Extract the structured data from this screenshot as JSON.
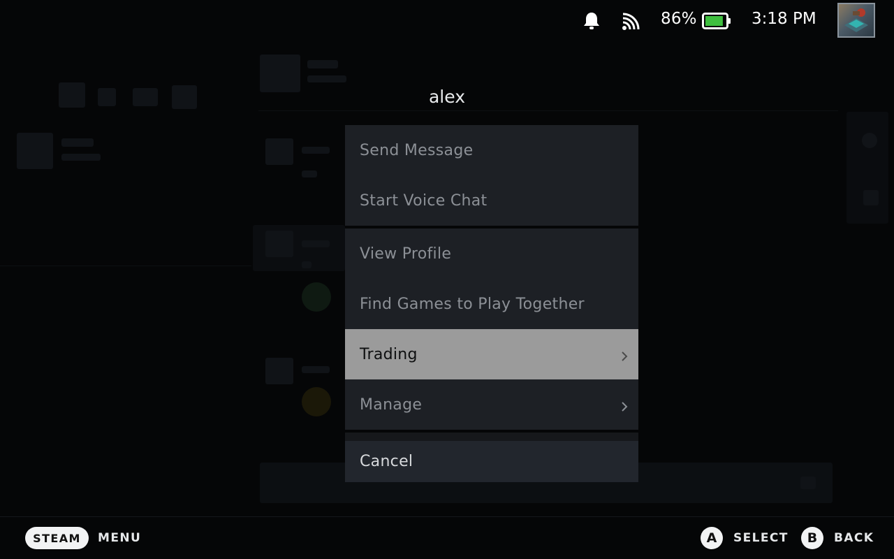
{
  "status_bar": {
    "notification_icon": "bell-icon",
    "network_icon": "wifi-icon",
    "battery_percent": "86%",
    "battery_level": 0.86,
    "battery_color": "#3fbf3f",
    "time": "3:18 PM",
    "avatar_icon": "user-avatar"
  },
  "context_menu": {
    "title": "alex",
    "groups": [
      [
        {
          "label": "Send Message"
        },
        {
          "label": "Start Voice Chat"
        }
      ],
      [
        {
          "label": "View Profile"
        },
        {
          "label": "Find Games to Play Together"
        },
        {
          "label": "Trading",
          "submenu": true,
          "selected": true
        },
        {
          "label": "Manage",
          "submenu": true
        }
      ]
    ],
    "cancel_label": "Cancel"
  },
  "bottom_bar": {
    "steam_label": "STEAM",
    "menu_label": "MENU",
    "a_button": "A",
    "select_label": "SELECT",
    "b_button": "B",
    "back_label": "BACK"
  }
}
